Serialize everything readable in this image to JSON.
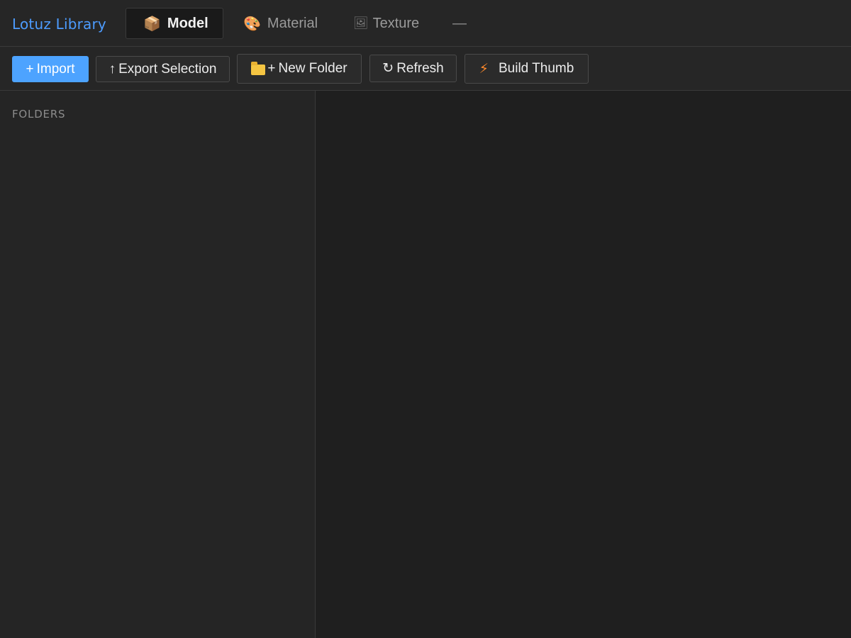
{
  "app": {
    "title": "Lotuz Library"
  },
  "tabs": [
    {
      "label": "Model",
      "icon": "package-icon",
      "glyph": "📦",
      "active": true
    },
    {
      "label": "Material",
      "icon": "palette-icon",
      "glyph": "🎨",
      "active": false
    },
    {
      "label": "Texture",
      "icon": "framed-picture-icon",
      "glyph": "🖼",
      "active": false
    },
    {
      "label": "—",
      "icon": "",
      "glyph": "",
      "active": false
    }
  ],
  "toolbar": {
    "import": {
      "icon_glyph": "+",
      "label": "Import"
    },
    "export": {
      "icon_glyph": "↑",
      "label": "Export Selection"
    },
    "new_folder": {
      "icon_glyph": "+",
      "label": "New Folder"
    },
    "refresh": {
      "icon_glyph": "↻",
      "label": "Refresh"
    },
    "build_thumb": {
      "icon_glyph": "⚡",
      "label": "Build Thumb"
    }
  },
  "sidebar": {
    "heading": "FOLDERS",
    "folders": []
  },
  "main": {
    "items": []
  },
  "colors": {
    "accent": "#4da3ff",
    "title": "#4d9cff",
    "background": "#1e1e1e",
    "panel": "#262626",
    "border": "#3a3a3a"
  }
}
